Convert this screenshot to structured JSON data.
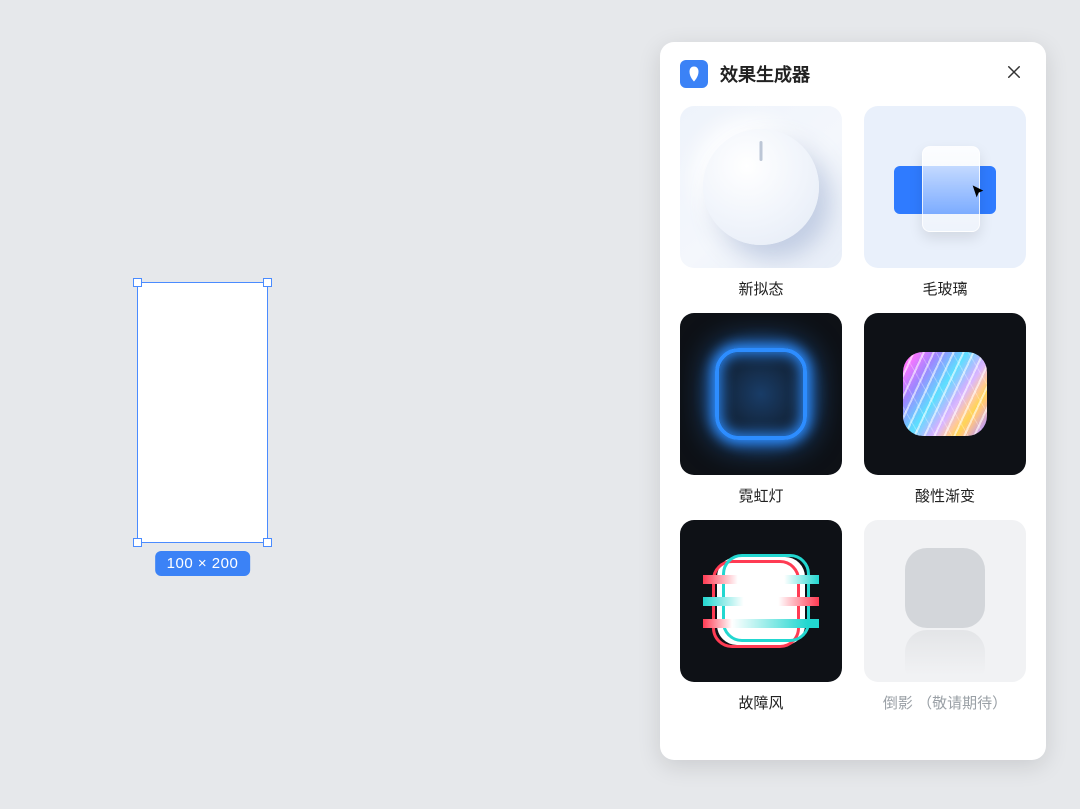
{
  "canvas": {
    "selection": {
      "size_label": "100 × 200"
    }
  },
  "panel": {
    "title": "效果生成器",
    "effects": [
      {
        "key": "neumorphism",
        "label": "新拟态"
      },
      {
        "key": "frosted-glass",
        "label": "毛玻璃"
      },
      {
        "key": "neon",
        "label": "霓虹灯"
      },
      {
        "key": "acid-gradient",
        "label": "酸性渐变"
      },
      {
        "key": "glitch",
        "label": "故障风"
      },
      {
        "key": "reflection",
        "label": "倒影 （敬请期待）",
        "disabled": true
      }
    ]
  }
}
